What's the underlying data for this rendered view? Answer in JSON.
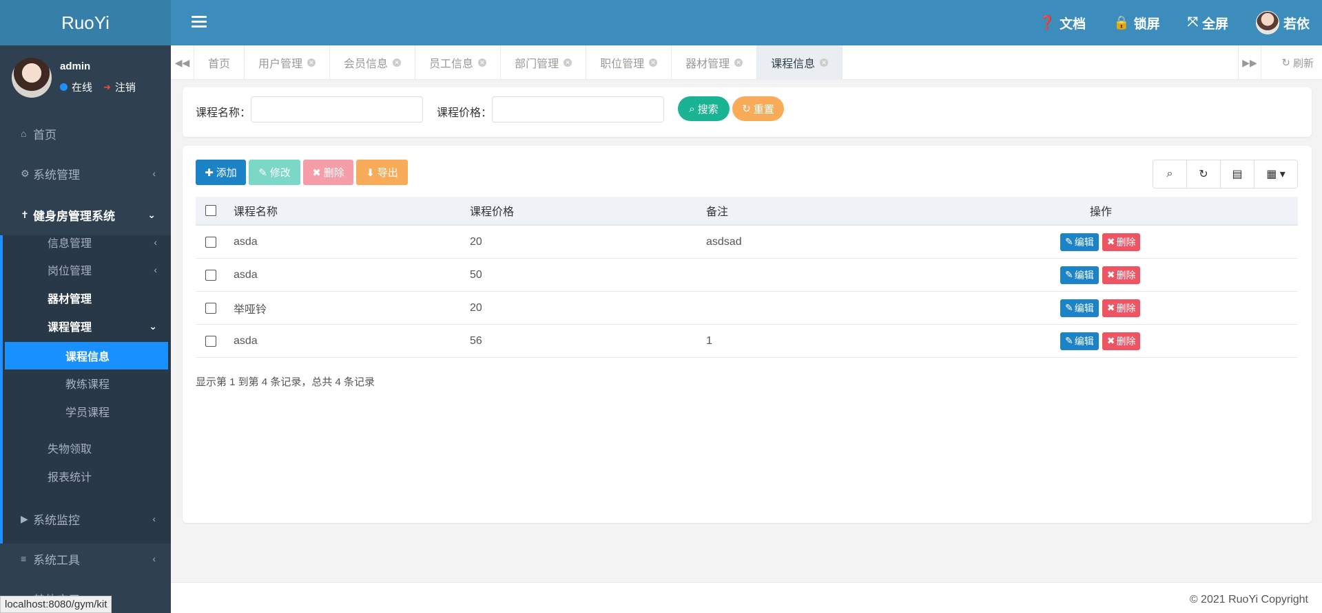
{
  "app": {
    "logo": "RuoYi"
  },
  "header": {
    "items": [
      {
        "icon": "question-circle-icon",
        "label": "文档"
      },
      {
        "icon": "lock-icon",
        "label": "锁屏"
      },
      {
        "icon": "fullscreen-icon",
        "label": "全屏"
      }
    ],
    "user_name": "若依"
  },
  "sidebar": {
    "user": {
      "name": "admin",
      "status": "在线",
      "logout": "注销"
    },
    "menu": [
      {
        "label": "首页",
        "icon": "home-icon"
      },
      {
        "label": "系统管理",
        "icon": "gear-icon"
      },
      {
        "label": "健身房管理系统",
        "icon": "dumbbell-icon"
      },
      {
        "label": "系统监控",
        "icon": "video-icon"
      },
      {
        "label": "系统工具",
        "icon": "bars-icon"
      },
      {
        "label": "其他应用",
        "icon": "apps-icon"
      }
    ],
    "submenu": [
      "信息管理",
      "岗位管理",
      "器材管理",
      "课程管理",
      "失物领取",
      "报表统计"
    ],
    "course_submenu": [
      "课程信息",
      "教练课程",
      "学员课程"
    ]
  },
  "tabs": {
    "items": [
      "首页",
      "用户管理",
      "会员信息",
      "员工信息",
      "部门管理",
      "职位管理",
      "器材管理",
      "课程信息"
    ],
    "active": "课程信息",
    "refresh": "刷新"
  },
  "search": {
    "name_label": "课程名称：",
    "price_label": "课程价格：",
    "name_value": "",
    "price_value": "",
    "search_btn": "搜索",
    "reset_btn": "重置"
  },
  "toolbar": {
    "add": "添加",
    "edit": "修改",
    "delete": "删除",
    "export": "导出"
  },
  "table": {
    "columns": [
      "课程名称",
      "课程价格",
      "备注",
      "操作"
    ],
    "rows": [
      {
        "name": "asda",
        "price": "20",
        "remark": "asdsad"
      },
      {
        "name": "asda",
        "price": "50",
        "remark": ""
      },
      {
        "name": "举哑铃",
        "price": "20",
        "remark": ""
      },
      {
        "name": "asda",
        "price": "56",
        "remark": "1"
      }
    ],
    "edit_label": "编辑",
    "delete_label": "删除",
    "pagination": "显示第 1 到第 4 条记录，总共 4 条记录"
  },
  "footer": {
    "copyright": "© 2021 RuoYi Copyright"
  },
  "status_url": "localhost:8080/gym/kit",
  "colors": {
    "header": "#3c8dbc",
    "sidebar": "#2f4050",
    "active": "#1890ff",
    "primary": "#1c84c6",
    "success": "#1ab394",
    "warning": "#f8ac59",
    "danger": "#ed5565"
  }
}
